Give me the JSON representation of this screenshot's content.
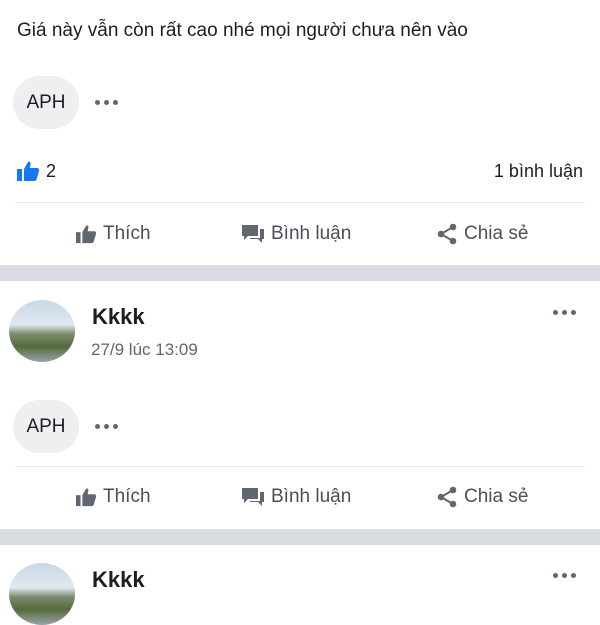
{
  "post1": {
    "text": "Giá này vẫn còn rất cao nhé mọi người chưa nên vào",
    "chip_label": "APH",
    "like_count": "2",
    "comment_count": "1 bình luận",
    "actions": {
      "like": "Thích",
      "comment": "Bình luận",
      "share": "Chia sẻ"
    }
  },
  "post2": {
    "author": "Kkkk",
    "timestamp": "27/9 lúc 13:09",
    "chip_label": "APH",
    "actions": {
      "like": "Thích",
      "comment": "Bình luận",
      "share": "Chia sẻ"
    }
  },
  "post3": {
    "author": "Kkkk"
  },
  "colors": {
    "like_blue": "#1877f2",
    "action_gray": "#606770",
    "separator": "#dadde1"
  },
  "icons": [
    "thumbs-up-icon",
    "comment-icon",
    "share-icon",
    "more-icon"
  ]
}
